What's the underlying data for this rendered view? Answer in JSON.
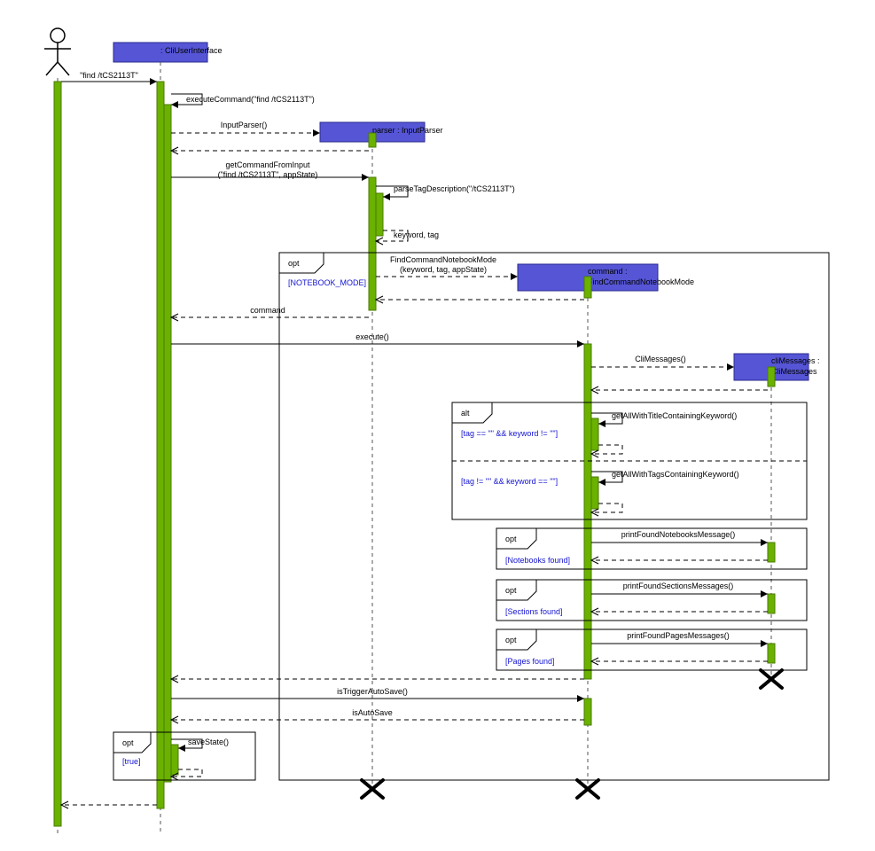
{
  "diagram": {
    "type": "uml-sequence",
    "lifelines": {
      "actor": {
        "kind": "actor",
        "label": ""
      },
      "cli": {
        "label": ": CliUserInterface"
      },
      "parser": {
        "label": "parser : InputParser"
      },
      "cmd": {
        "label": "command :\nFindCommandNotebookMode"
      },
      "msgs": {
        "label": "cliMessages :\nCliMessages"
      }
    },
    "messages": {
      "m1": "\"find /tCS2113T\"",
      "m2": "executeCommand(\"find /tCS2113T\")",
      "m3": "InputParser()",
      "m4a": "getCommandFromInput",
      "m4b": "(\"find /tCS2113T\", appState)",
      "m5": "parseTagDescription(\"/tCS2113T\")",
      "m6": "keyword, tag",
      "m7a": "FindCommandNotebookMode",
      "m7b": "(keyword, tag, appState)",
      "m8": "command",
      "m9": "execute()",
      "m10": "CliMessages()",
      "m11": "getAllWithTitleContainingKeyword()",
      "m12": "getAllWithTagsContainingKeyword()",
      "m13": "printFoundNotebooksMessage()",
      "m14": "printFoundSectionsMessages()",
      "m15": "printFoundPagesMessages()",
      "m16": "isTriggerAutoSave()",
      "m17": "isAutoSave",
      "m18": "saveState()"
    },
    "fragments": {
      "opt1": {
        "kind": "opt",
        "guard": "[NOTEBOOK_MODE]"
      },
      "alt": {
        "kind": "alt",
        "guard1": "[tag == \"\" && keyword != \"\"]",
        "guard2": "[tag != \"\" && keyword == \"\"]"
      },
      "optNB": {
        "kind": "opt",
        "guard": "[Notebooks found]"
      },
      "optSec": {
        "kind": "opt",
        "guard": "[Sections found]"
      },
      "optPg": {
        "kind": "opt",
        "guard": "[Pages found]"
      },
      "optSave": {
        "kind": "opt",
        "guard": "[true]"
      }
    }
  }
}
